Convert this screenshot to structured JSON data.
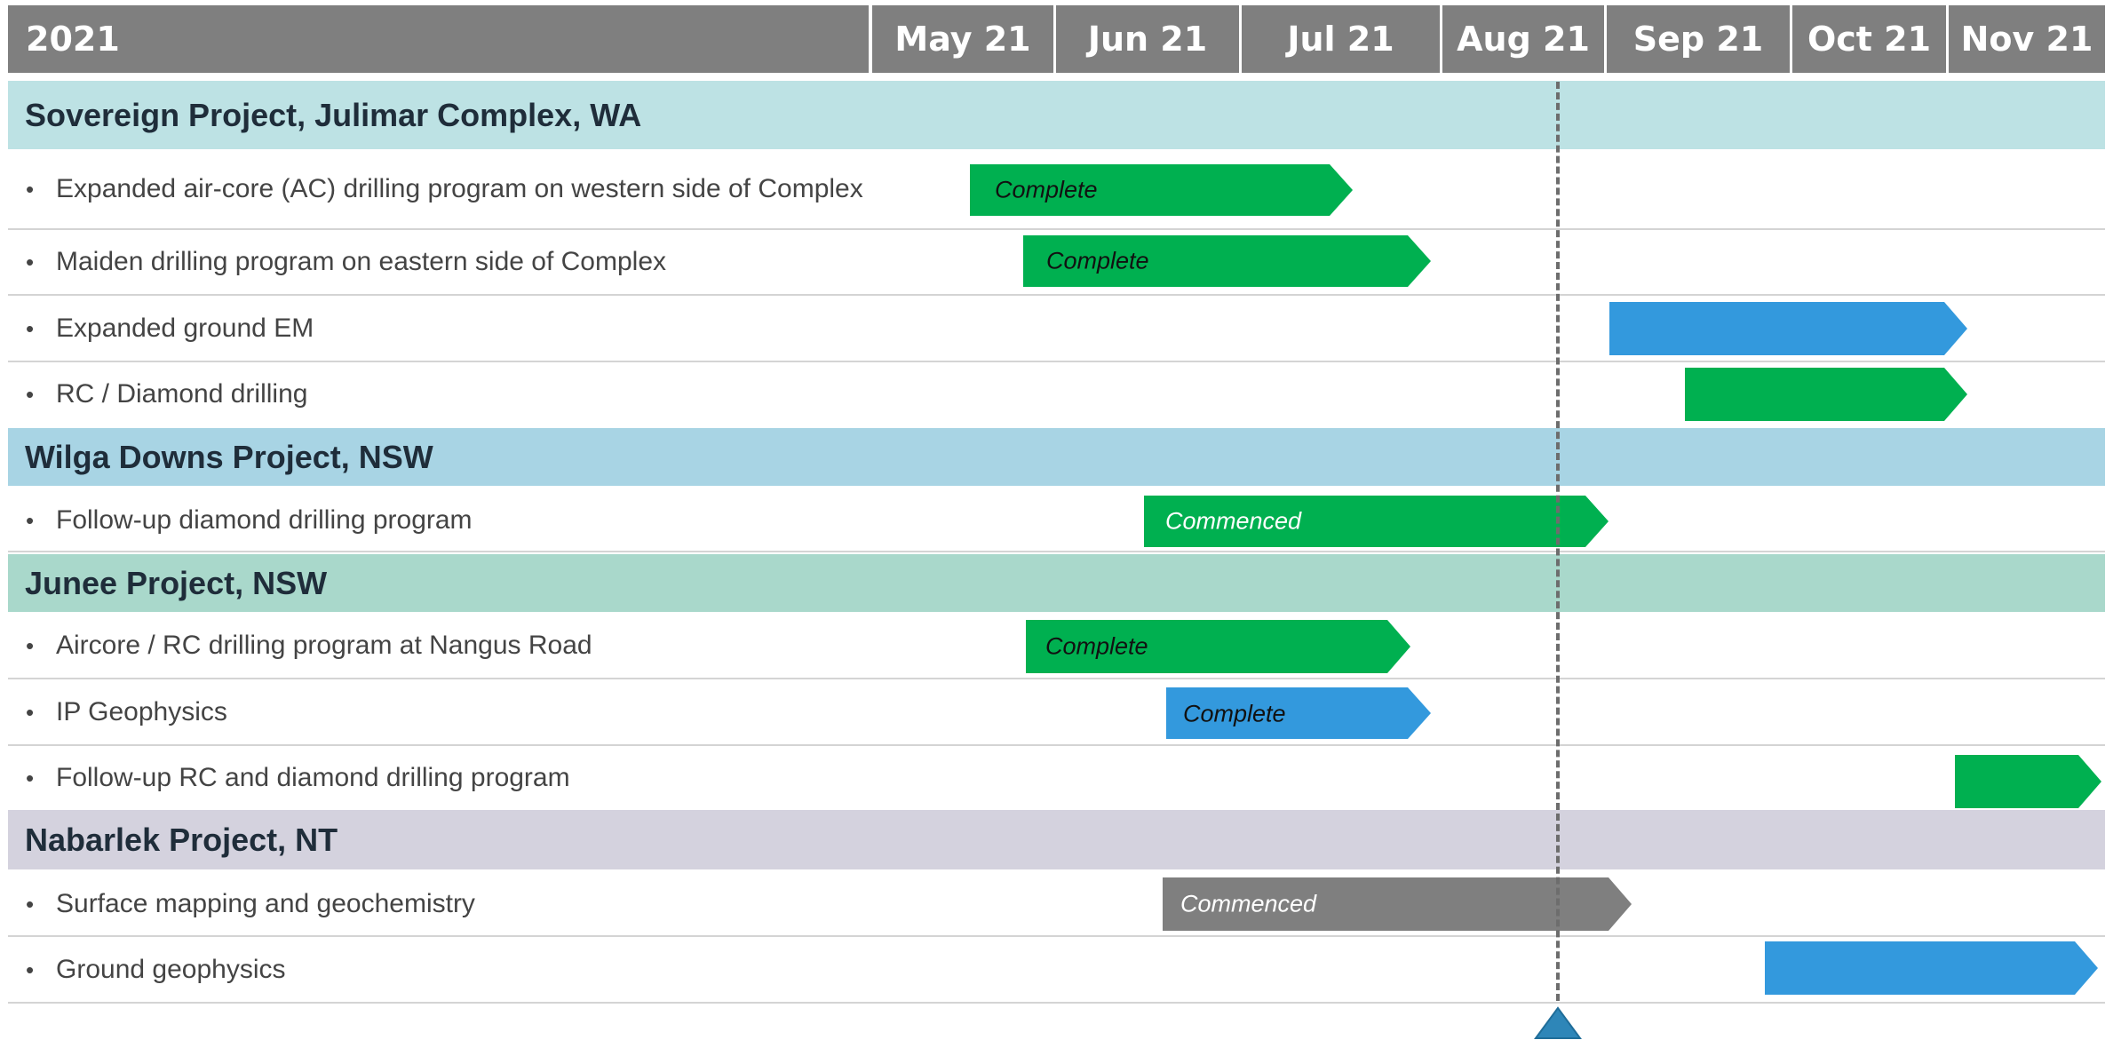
{
  "header": {
    "year": "2021",
    "months": [
      "May 21",
      "Jun 21",
      "Jul 21",
      "Aug 21",
      "Sep 21",
      "Oct 21",
      "Nov 21"
    ]
  },
  "colors": {
    "header": "#7f7f7f",
    "green": "#00b050",
    "blue": "#3399dd",
    "grey": "#7f7f7f",
    "band_sovereign": "#bde2e4",
    "band_wilga": "#a8d4e4",
    "band_junee": "#a9d8cb",
    "band_nabarlek": "#d4d2de",
    "today_marker": "#2e86b8"
  },
  "projects": [
    {
      "name": "Sovereign Project, Julimar Complex, WA",
      "tasks": [
        {
          "label": "Expanded air-core (AC) drilling program on western side of Complex",
          "bar_label": "Complete",
          "color": "green"
        },
        {
          "label": "Maiden drilling program on eastern side of Complex",
          "bar_label": "Complete",
          "color": "green"
        },
        {
          "label": "Expanded ground EM",
          "bar_label": "",
          "color": "blue"
        },
        {
          "label": "RC / Diamond drilling",
          "bar_label": "",
          "color": "green"
        }
      ]
    },
    {
      "name": "Wilga Downs Project, NSW",
      "tasks": [
        {
          "label": "Follow-up diamond drilling program",
          "bar_label": "Commenced",
          "color": "green"
        }
      ]
    },
    {
      "name": "Junee Project, NSW",
      "tasks": [
        {
          "label": "Aircore / RC drilling program at Nangus Road",
          "bar_label": "Complete",
          "color": "green"
        },
        {
          "label": "IP Geophysics",
          "bar_label": "Complete",
          "color": "blue"
        },
        {
          "label": "Follow-up RC and diamond drilling program",
          "bar_label": "",
          "color": "green"
        }
      ]
    },
    {
      "name": "Nabarlek Project, NT",
      "tasks": [
        {
          "label": "Surface mapping and geochemistry",
          "bar_label": "Commenced",
          "color": "grey"
        },
        {
          "label": "Ground geophysics",
          "bar_label": "",
          "color": "blue"
        }
      ]
    }
  ]
}
